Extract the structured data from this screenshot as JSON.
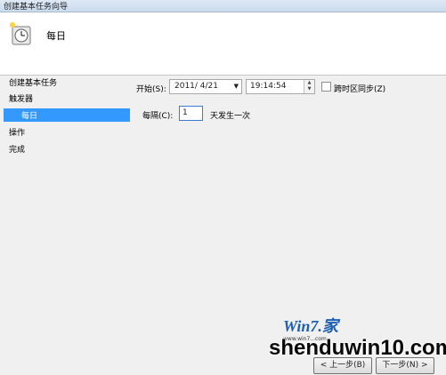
{
  "window": {
    "title": "创建基本任务向导"
  },
  "header": {
    "title": "每日",
    "icon": "scheduled-clock-icon"
  },
  "nav": {
    "items": [
      {
        "label": "创建基本任务",
        "selected": false
      },
      {
        "label": "触发器",
        "selected": false
      },
      {
        "label": "每日",
        "selected": true
      },
      {
        "label": "操作",
        "selected": false
      },
      {
        "label": "完成",
        "selected": false
      }
    ]
  },
  "trigger": {
    "start_label": "开始(S):",
    "start_date": "2011/ 4/21",
    "start_time": "19:14:54",
    "sync_timezones_label": "跨时区同步(Z)",
    "sync_timezones_checked": false,
    "recur_label": "每隔(C):",
    "recur_value": "1",
    "recur_suffix": "天发生一次"
  },
  "buttons": {
    "back_label": "< 上一步(B)",
    "next_label": "下一步(N) >"
  },
  "watermark": {
    "logo": "Win7.家",
    "url": "www.win7...com",
    "text": "shenduwin10.com"
  },
  "colors": {
    "selection": "#3399ff",
    "header_bg": "#ffffff",
    "panel_bg": "#f0f0f0"
  }
}
